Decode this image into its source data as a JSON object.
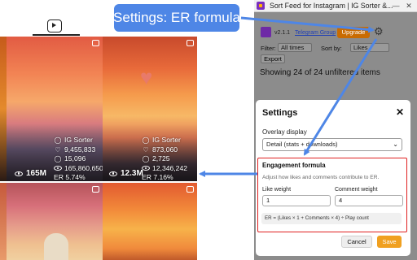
{
  "callout": {
    "text": "Settings: ER formula"
  },
  "window": {
    "title": "Sort Feed for Instagram | IG Sorter &...",
    "minimize": "—",
    "close": "✕"
  },
  "header": {
    "version": "v2.1.1",
    "telegram_link": "Telegram Group",
    "upgrade_label": "Upgrade"
  },
  "filters": {
    "filter_label": "Filter:",
    "filter_value": "All times",
    "sort_label": "Sort by:",
    "sort_value": "Likes",
    "export_label": "Export",
    "showing_text": "Showing 24 of 24 unfiltered items"
  },
  "modal": {
    "title": "Settings",
    "close": "✕",
    "overlay_label": "Overlay display",
    "overlay_value": "Detail (stats + downloads)",
    "er": {
      "title": "Engagement formula",
      "description": "Adjust how likes and comments contribute to ER.",
      "like_label": "Like weight",
      "like_value": "1",
      "comment_label": "Comment weight",
      "comment_value": "4",
      "formula": "ER = (Likes × 1 + Comments × 4) ÷ Play count"
    },
    "cancel_label": "Cancel",
    "save_label": "Save"
  },
  "tiles": [
    {
      "source": "IG Sorter",
      "likes": "9,455,833",
      "comments": "15,096",
      "plays": "165,860,650",
      "er": "ER 5.74%",
      "views": "165M"
    },
    {
      "source": "IG Sorter",
      "likes": "873,060",
      "comments": "2,725",
      "plays": "12,346,242",
      "er": "ER 7.16%",
      "views": "12.3M"
    }
  ],
  "colors": {
    "callout": "#4e86e6",
    "upgrade": "#c96b00",
    "save": "#f0a020",
    "highlight": "#e02020",
    "arrow": "#4e86e6"
  }
}
